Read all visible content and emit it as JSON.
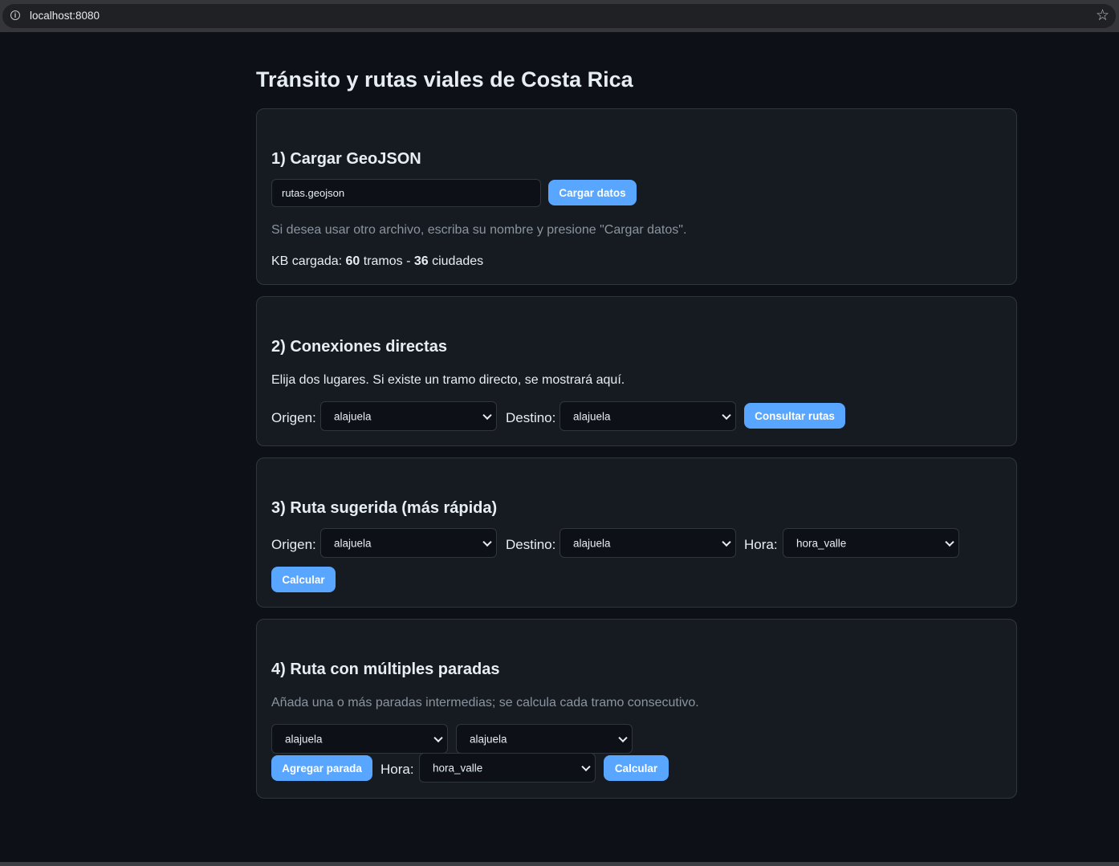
{
  "browser": {
    "url": "localhost:8080"
  },
  "page": {
    "title": "Tránsito y rutas viales de Costa Rica"
  },
  "section1": {
    "heading": "1) Cargar GeoJSON",
    "file_input_value": "rutas.geojson",
    "load_button": "Cargar datos",
    "hint": "Si desea usar otro archivo, escriba su nombre y presione \"Cargar datos\".",
    "kb_prefix": "KB cargada: ",
    "tramos_count": "60",
    "tramos_label": " tramos - ",
    "ciudades_count": "36",
    "ciudades_label": " ciudades"
  },
  "section2": {
    "heading": "2) Conexiones directas",
    "description": "Elija dos lugares. Si existe un tramo directo, se mostrará aquí.",
    "origin_label": "Origen:",
    "origin_value": "alajuela",
    "destination_label": "Destino:",
    "destination_value": "alajuela",
    "query_button": "Consultar rutas"
  },
  "section3": {
    "heading": "3) Ruta sugerida (más rápida)",
    "origin_label": "Origen:",
    "origin_value": "alajuela",
    "destination_label": "Destino:",
    "destination_value": "alajuela",
    "time_label": "Hora:",
    "time_value": "hora_valle",
    "calculate_button": "Calcular"
  },
  "section4": {
    "heading": "4) Ruta con múltiples paradas",
    "description": "Añada una o más paradas intermedias; se calcula cada tramo consecutivo.",
    "stop1_value": "alajuela",
    "stop2_value": "alajuela",
    "add_stop_button": "Agregar parada",
    "time_label": "Hora:",
    "time_value": "hora_valle",
    "calculate_button": "Calcular"
  }
}
